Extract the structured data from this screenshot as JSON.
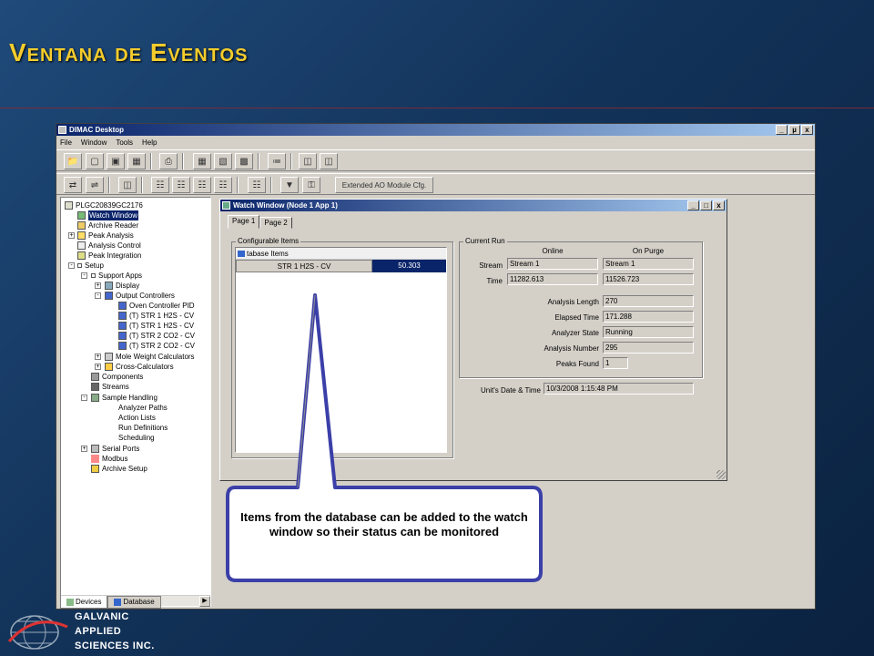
{
  "slide": {
    "title": "Ventana de Eventos"
  },
  "app": {
    "title": "DIMAC Desktop",
    "window_buttons": [
      "_",
      "µ",
      "x"
    ],
    "menu": [
      "File",
      "Window",
      "Tools",
      "Help"
    ],
    "toolbar2_text_button": "Extended AO Module Cfg."
  },
  "tree": {
    "items": [
      {
        "label": "PLGC20839GC2176"
      },
      {
        "label": "Watch Window"
      },
      {
        "label": "Archive Reader"
      },
      {
        "label": "Peak Analysis"
      },
      {
        "label": "Analysis Control"
      },
      {
        "label": "Peak Integration"
      },
      {
        "label": "Setup"
      },
      {
        "label": "Support Apps"
      },
      {
        "label": "Display"
      },
      {
        "label": "Output Controllers"
      },
      {
        "label": "Oven Controller PID"
      },
      {
        "label": "(T) STR 1 H2S - CV"
      },
      {
        "label": "(T) STR 1 H2S - CV"
      },
      {
        "label": "(T) STR 2 CO2 - CV"
      },
      {
        "label": "(T) STR 2 CO2 - CV"
      },
      {
        "label": "Mole Weight Calculators"
      },
      {
        "label": "Cross-Calculators"
      },
      {
        "label": "Components"
      },
      {
        "label": "Streams"
      },
      {
        "label": "Sample Handling"
      },
      {
        "label": "Analyzer Paths"
      },
      {
        "label": "Action Lists"
      },
      {
        "label": "Run Definitions"
      },
      {
        "label": "Scheduling"
      },
      {
        "label": "Serial Ports"
      },
      {
        "label": "Modbus"
      },
      {
        "label": "Archive Setup"
      }
    ],
    "bottom_tabs": [
      "Devices",
      "Database"
    ]
  },
  "watch": {
    "title": "Watch Window (Node 1 App 1)",
    "tabs": [
      "Page 1",
      "Page 2"
    ],
    "configurable": {
      "label": "Configurable Items",
      "db_header": "tabase Items",
      "row_name": "STR 1 H2S - CV",
      "row_value": "50.303"
    },
    "current_run": {
      "label": "Current Run",
      "col_online": "Online",
      "col_purge": "On Purge",
      "stream_label": "Stream",
      "stream_online": "Stream 1",
      "stream_purge": "Stream 1",
      "time_label": "Time",
      "time_online": "11282.613",
      "time_purge": "11526.723",
      "analysis_length_label": "Analysis Length",
      "analysis_length": "270",
      "elapsed_label": "Elapsed Time",
      "elapsed": "171.288",
      "state_label": "Analyzer State",
      "state": "Running",
      "number_label": "Analysis Number",
      "number": "295",
      "peaks_label": "Peaks Found",
      "peaks": "1"
    },
    "datetime_label": "Unit's Date & Time",
    "datetime": "10/3/2008 1:15:48 PM"
  },
  "callout": {
    "text": "Items from the database can be added to the watch window so their status can be monitored"
  },
  "logo": {
    "line1": "GALVANIC",
    "line2": "APPLIED",
    "line3": "SCIENCES INC."
  },
  "colors": {
    "title_yellow": "#f4cc2c",
    "selection_blue": "#0a246a",
    "logo_red": "#e04848"
  }
}
